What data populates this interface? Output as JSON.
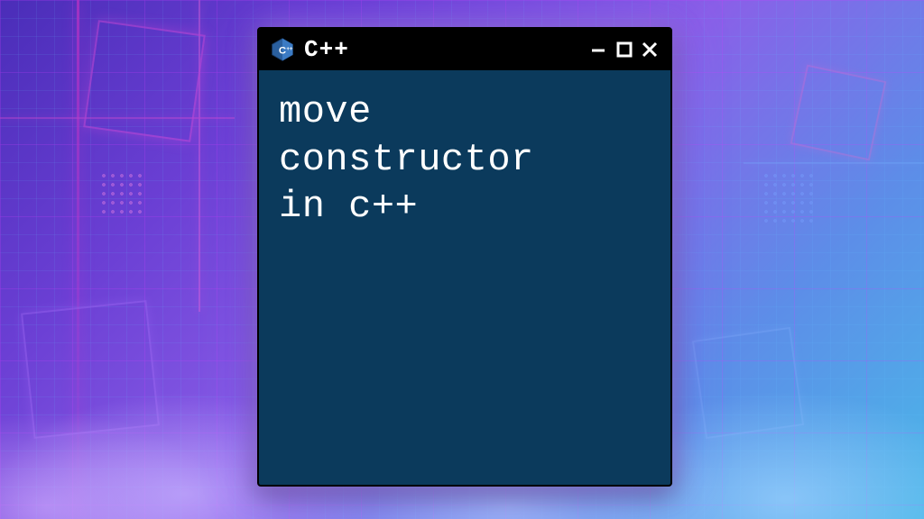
{
  "window": {
    "title": "C++",
    "icon_name": "cpp-logo-icon"
  },
  "content": {
    "line1": "move",
    "line2": "constructor",
    "line3": "in c++"
  },
  "colors": {
    "terminal_bg": "#0b3a5c",
    "titlebar_bg": "#000000",
    "text": "#ffffff"
  }
}
